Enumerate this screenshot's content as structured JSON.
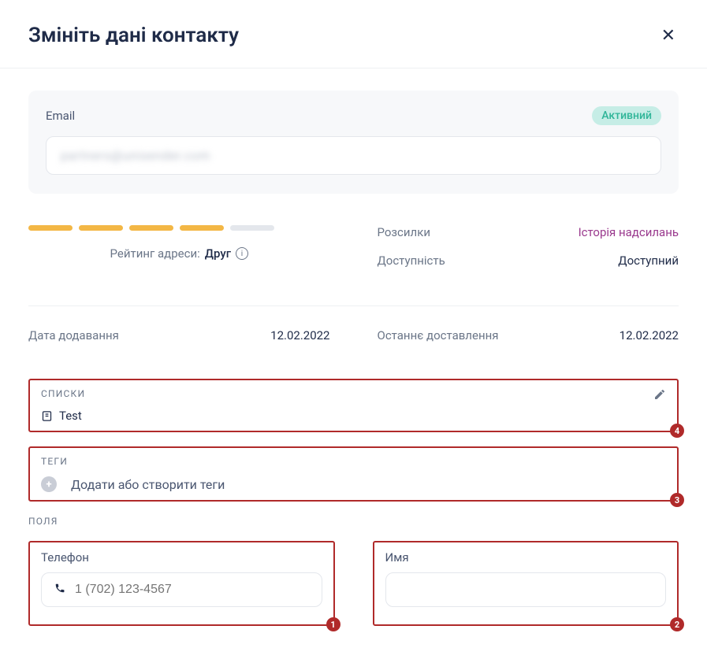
{
  "modal": {
    "title": "Змініть дані контакту"
  },
  "email": {
    "label": "Email",
    "status": "Активний",
    "value_blurred": "partners@unisender.com"
  },
  "rating": {
    "label": "Рейтинг адреси:",
    "value": "Друг",
    "filled": 4,
    "total": 5
  },
  "right_info": {
    "mailings_label": "Розсилки",
    "mailings_link": "Історія надсилань",
    "availability_label": "Доступність",
    "availability_value": "Доступний"
  },
  "dates": {
    "added_label": "Дата додавання",
    "added_value": "12.02.2022",
    "last_delivery_label": "Останнє доставлення",
    "last_delivery_value": "12.02.2022"
  },
  "lists": {
    "header": "СПИСКИ",
    "items": [
      "Test"
    ]
  },
  "tags": {
    "header": "ТЕГИ",
    "placeholder": "Додати або створити теги"
  },
  "fields": {
    "header": "ПОЛЯ",
    "phone": {
      "label": "Телефон",
      "placeholder": "1 (702) 123-4567"
    },
    "name": {
      "label": "Имя",
      "placeholder": ""
    }
  },
  "annotations": {
    "lists": "4",
    "tags": "3",
    "phone": "1",
    "name": "2"
  }
}
